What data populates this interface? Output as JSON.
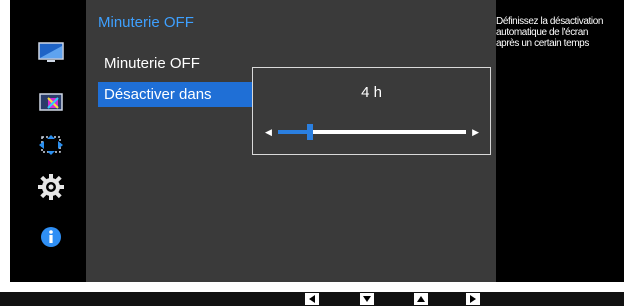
{
  "menu": {
    "title": "Minuterie OFF",
    "items": [
      {
        "label": "Minuterie OFF",
        "selected": false
      },
      {
        "label": "Désactiver dans",
        "selected": true
      }
    ]
  },
  "popup": {
    "value": "4 h",
    "slider_level_fraction": 0.17
  },
  "help": {
    "text": "Définissez la désactivation\nautomatique de l'écran\naprès un certain temps"
  },
  "sidebar": {
    "icons": [
      "picture-icon",
      "color-icon",
      "screen-size-icon",
      "gear-icon",
      "info-icon"
    ]
  },
  "bottom_bar": {
    "buttons": [
      "left-arrow-icon",
      "down-arrow-icon",
      "up-arrow-icon",
      "right-arrow-icon"
    ]
  },
  "colors": {
    "accent": "#3ea0ff",
    "selection": "#1f6fd6",
    "panel": "#3a3a3a",
    "background": "#000000"
  }
}
